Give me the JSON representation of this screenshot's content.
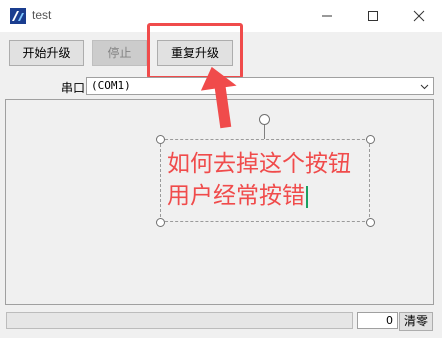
{
  "window": {
    "title": "test",
    "icon": "app-icon",
    "controls": [
      "minimize-icon",
      "maximize-icon",
      "close-icon"
    ]
  },
  "toolbar": {
    "start_label": "开始升级",
    "stop_label": "停止",
    "retry_label": "重复升级"
  },
  "port": {
    "label": "串口",
    "selected": "(COM1)"
  },
  "annotation": {
    "line1": "如何去掉这个按钮",
    "line2": "用户经常按错",
    "color": "#f04b4b"
  },
  "status": {
    "count": "0",
    "clear_label": "清零"
  }
}
